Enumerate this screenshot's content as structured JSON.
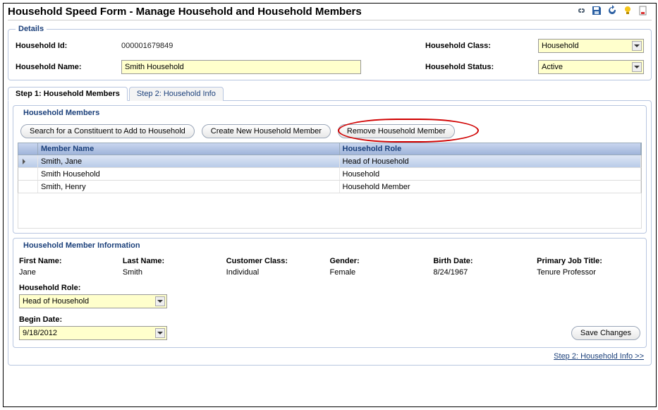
{
  "title": "Household Speed Form - Manage Household and Household Members",
  "details": {
    "legend": "Details",
    "household_id_label": "Household Id:",
    "household_id_value": "000001679849",
    "household_name_label": "Household Name:",
    "household_name_value": "Smith Household",
    "household_class_label": "Household Class:",
    "household_class_value": "Household",
    "household_status_label": "Household Status:",
    "household_status_value": "Active"
  },
  "tabs": {
    "step1": "Step 1: Household Members",
    "step2": "Step 2: Household Info"
  },
  "members_area": {
    "legend": "Household Members",
    "btn_search": "Search for a Constituent to Add to Household",
    "btn_create": "Create New Household Member",
    "btn_remove": "Remove Household Member",
    "col_member": "Member Name",
    "col_role": "Household Role",
    "rows": [
      {
        "name": "Smith, Jane",
        "role": "Head of Household",
        "selected": true
      },
      {
        "name": "Smith Household",
        "role": "Household",
        "selected": false
      },
      {
        "name": "Smith, Henry",
        "role": "Household Member",
        "selected": false
      }
    ]
  },
  "member_info": {
    "legend": "Household Member Information",
    "first_name_label": "First Name:",
    "first_name_value": "Jane",
    "last_name_label": "Last Name:",
    "last_name_value": "Smith",
    "customer_class_label": "Customer Class:",
    "customer_class_value": "Individual",
    "gender_label": "Gender:",
    "gender_value": "Female",
    "birth_date_label": "Birth Date:",
    "birth_date_value": "8/24/1967",
    "primary_job_label": "Primary Job Title:",
    "primary_job_value": "Tenure Professor",
    "household_role_label": "Household Role:",
    "household_role_value": "Head of Household",
    "begin_date_label": "Begin Date:",
    "begin_date_value": "9/18/2012",
    "save_changes": "Save Changes"
  },
  "footer_link": "Step 2: Household Info >>"
}
